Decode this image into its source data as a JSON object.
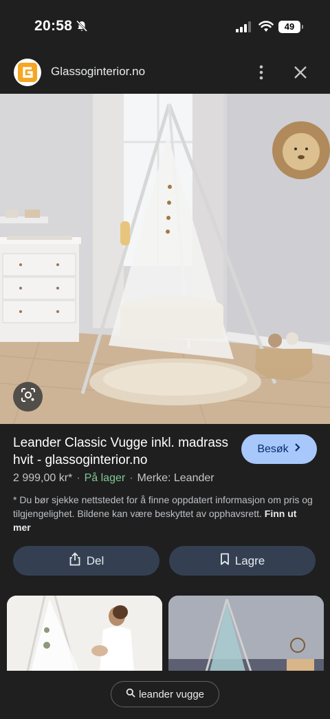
{
  "status_bar": {
    "time": "20:58",
    "battery": "49",
    "icons": [
      "bell-slash-icon",
      "signal-icon",
      "wifi-icon",
      "battery-icon"
    ]
  },
  "header": {
    "site_name": "Glassoginterior.no",
    "logo_letter": "G",
    "logo_color": "#f5a623",
    "icons": [
      "more-vert-icon",
      "close-icon"
    ]
  },
  "hero": {
    "icon": "google-lens-icon"
  },
  "product": {
    "title": "Leander Classic Vugge inkl. madrass hvit - glassoginterior.no",
    "visit_label": "Besøk",
    "price": "2 999,00 kr*",
    "stock": "På lager",
    "brand": "Merke: Leander",
    "disclaimer": "* Du bør sjekke nettstedet for å finne oppdatert informasjon om pris og tilgjengelighet. Bildene kan være beskyttet av opphavsrett.",
    "more_link": "Finn ut mer"
  },
  "actions": {
    "share_label": "Del",
    "save_label": "Lagre"
  },
  "bottom": {
    "search_query": "leander vugge"
  },
  "colors": {
    "background": "#1f1f1f",
    "visit_button": "#a8c7fa",
    "action_button": "#344052",
    "stock_green": "#81c995"
  }
}
